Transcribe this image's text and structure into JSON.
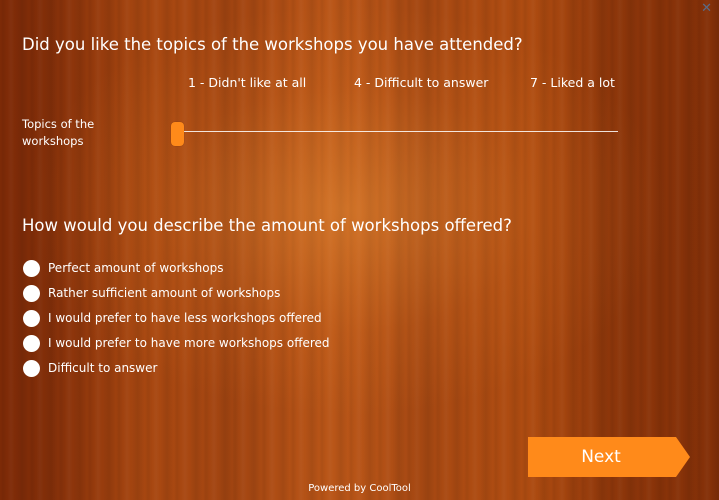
{
  "window": {
    "close_symbol": "✕"
  },
  "question1": {
    "title": "Did you like the topics of the workshops you have attended?",
    "scale_labels": [
      "1 - Didn't like at all",
      "4 - Difficult to answer",
      "7 - Liked a lot"
    ],
    "row_label": "Topics of the workshops",
    "slider_value": 1
  },
  "question2": {
    "title": "How would you describe the amount of workshops offered?",
    "options": [
      "Perfect amount of workshops",
      "Rather sufficient amount of workshops",
      "I would prefer to have less workshops offered",
      "I would prefer to have more workshops offered",
      "Difficult to answer"
    ]
  },
  "navigation": {
    "next_label": "Next"
  },
  "footer": {
    "text": "Powered by CoolTool"
  },
  "colors": {
    "accent": "#ff8a1a",
    "text": "#ffffff",
    "close_icon": "#5a6b86"
  }
}
